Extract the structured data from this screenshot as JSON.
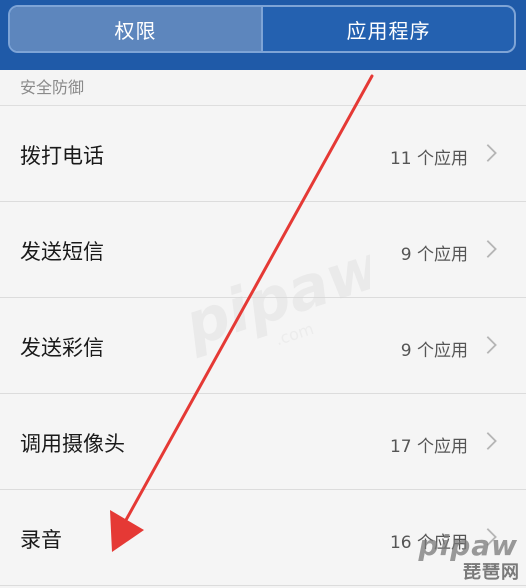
{
  "tabs": [
    {
      "label": "权限",
      "active": true
    },
    {
      "label": "应用程序",
      "active": false
    }
  ],
  "section": {
    "title": "安全防御"
  },
  "items": [
    {
      "label": "拨打电话",
      "count": "11 个应用"
    },
    {
      "label": "发送短信",
      "count": "9 个应用"
    },
    {
      "label": "发送彩信",
      "count": "9 个应用"
    },
    {
      "label": "调用摄像头",
      "count": "17 个应用"
    },
    {
      "label": "录音",
      "count": "16 个应用"
    }
  ],
  "watermark": {
    "logo": "pipaw",
    "site": "琵琶网"
  },
  "icons": {
    "chevron": "chevron-right-icon",
    "annotation": "red-arrow-annotation"
  },
  "colors": {
    "header": "#1f5aa8",
    "tab_active": "#5d86bd",
    "arrow": "#e53935"
  }
}
